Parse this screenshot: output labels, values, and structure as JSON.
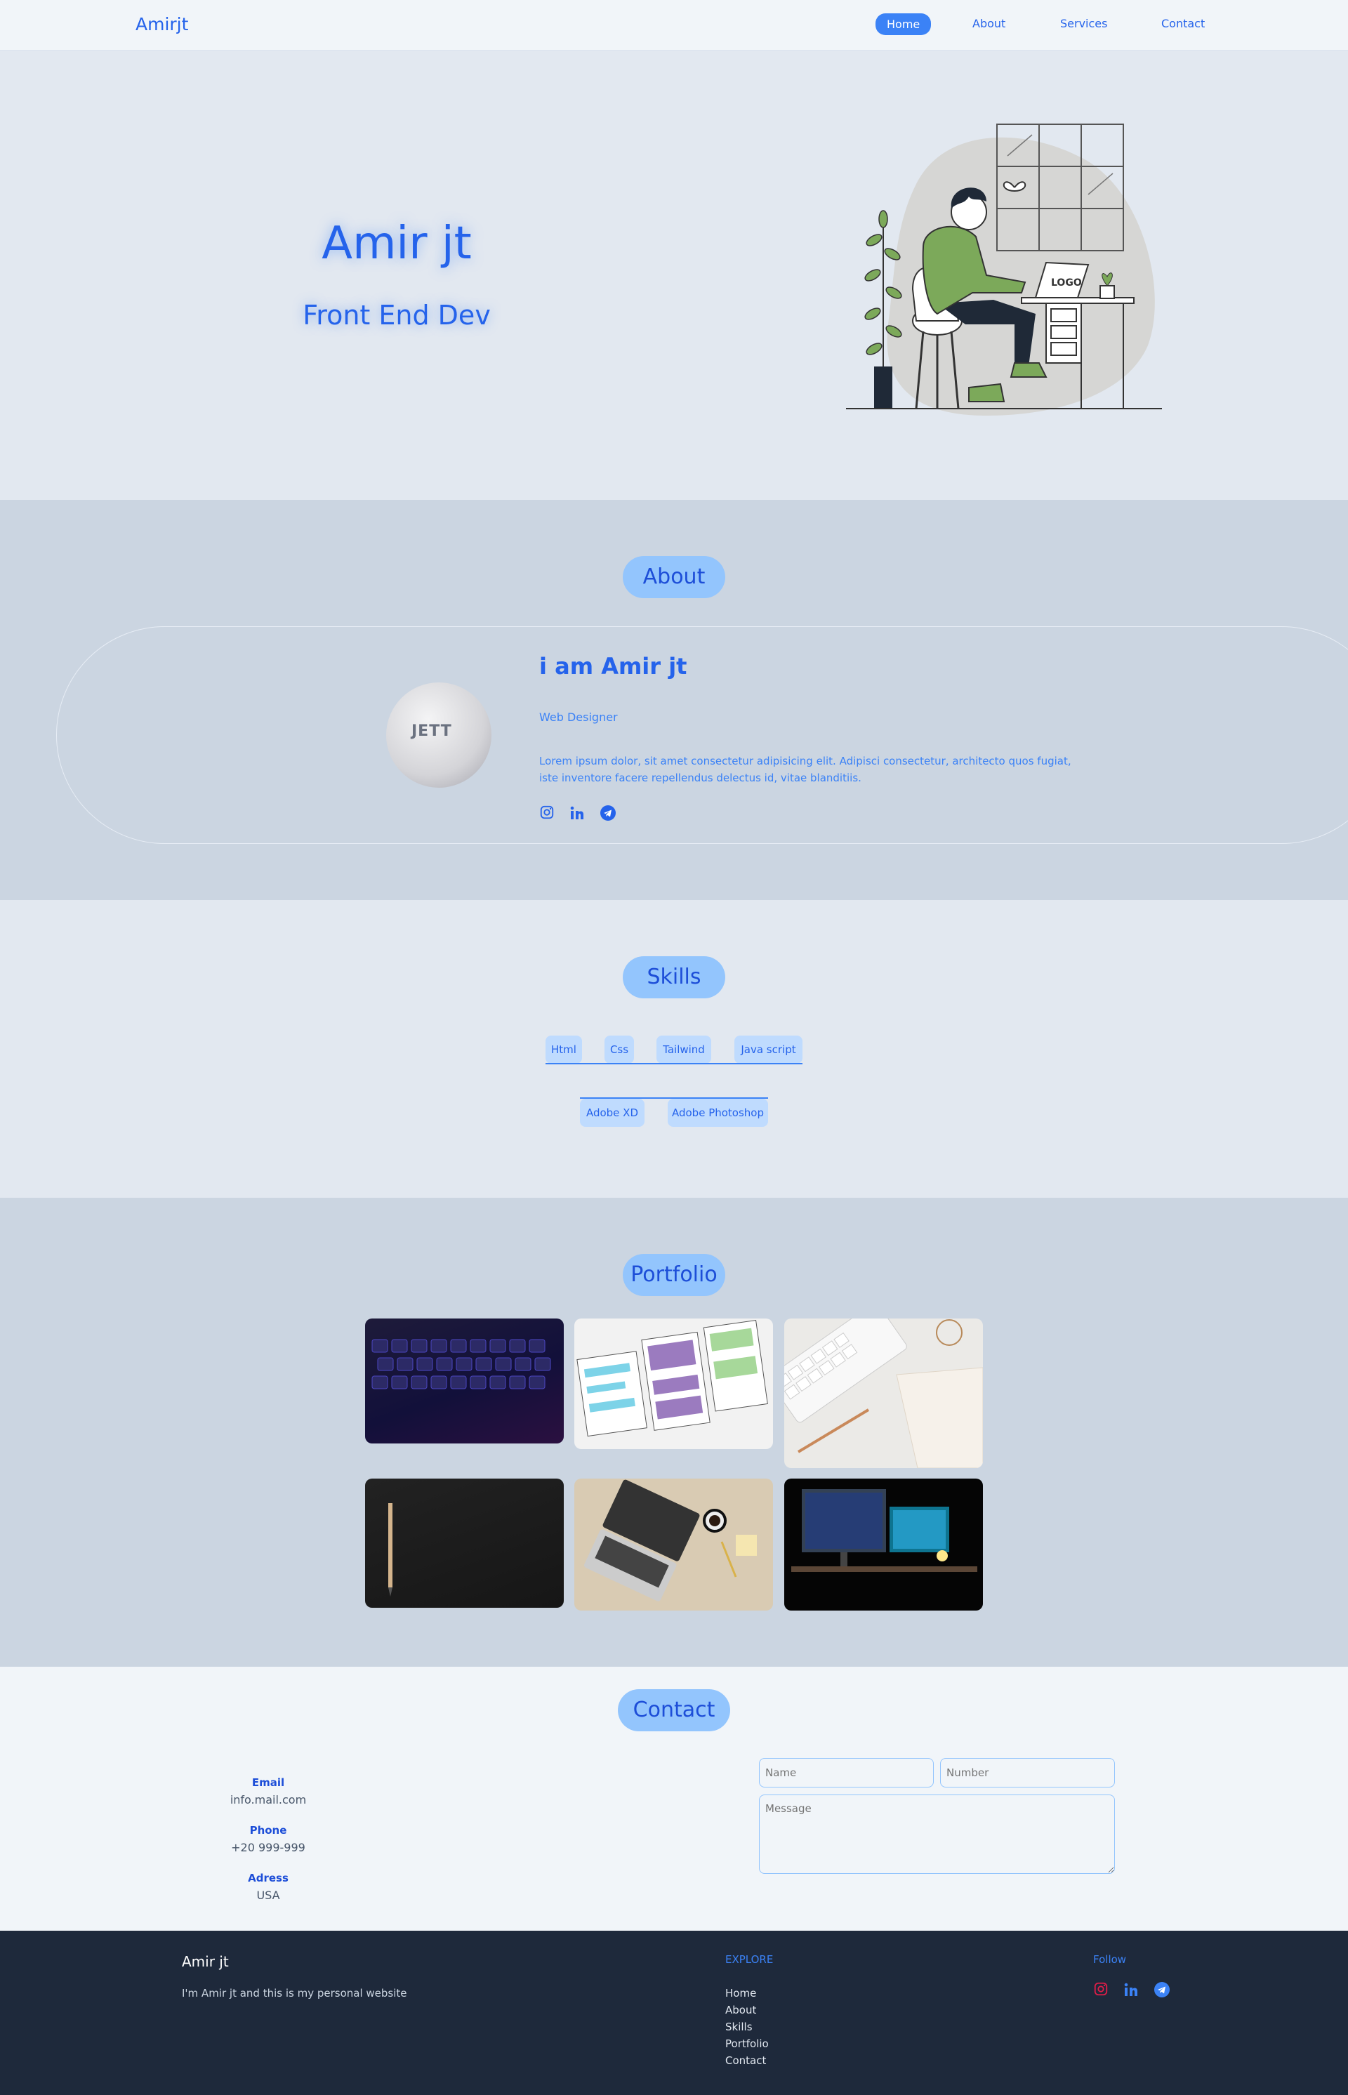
{
  "nav": {
    "brand": "Amirjt",
    "items": [
      "Home",
      "About",
      "Services",
      "Contact"
    ],
    "active": "Home"
  },
  "hero": {
    "title": "Amir jt",
    "subtitle": "Front End Dev",
    "illustration_text": "LOGO"
  },
  "about": {
    "heading": "About",
    "avatar_text": "JETT",
    "name": "i am Amir jt",
    "role": "Web Designer",
    "text": "Lorem ipsum dolor, sit amet consectetur adipisicing elit. Adipisci consectetur, architecto quos fugiat, iste inventore facere repellendus delectus id, vitae blanditiis.",
    "social": [
      "instagram-icon",
      "linkedin-icon",
      "telegram-icon"
    ]
  },
  "skills": {
    "heading": "Skills",
    "row1": [
      "Html",
      "Css",
      "Tailwind",
      "Java script"
    ],
    "row2": [
      "Adobe XD",
      "Adobe Photoshop"
    ]
  },
  "portfolio": {
    "heading": "Portfolio",
    "items": [
      "keyboard-photo",
      "wireframe-sketch-photo",
      "desk-keyboard-photo",
      "pencil-photo",
      "laptop-coffee-photo",
      "monitor-setup-photo"
    ]
  },
  "contact": {
    "heading": "Contact",
    "email_label": "Email",
    "email": "info.mail.com",
    "phone_label": "Phone",
    "phone": "+20 999-999",
    "address_label": "Adress",
    "address": "USA",
    "name_placeholder": "Name",
    "number_placeholder": "Number",
    "message_placeholder": "Message"
  },
  "footer": {
    "brand": "Amir jt",
    "description": "I'm Amir jt and this is my personal website",
    "explore_heading": "EXPLORE",
    "links": [
      "Home",
      "About",
      "Skills",
      "Portfolio",
      "Contact"
    ],
    "follow_heading": "Follow"
  },
  "colors": {
    "accent": "#2563eb",
    "pill": "#93c5fd",
    "footer_bg": "#1e293b",
    "section_alt": "#cbd5e1",
    "section_bg": "#e2e8f0"
  }
}
